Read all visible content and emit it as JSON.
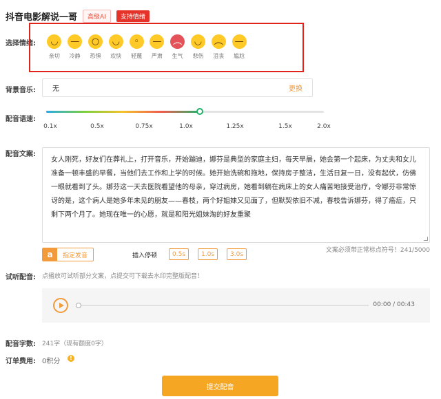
{
  "header": {
    "title": "抖音电影解说一哥",
    "badge_ai": "高级AI",
    "badge_emotion": "支持情绪"
  },
  "labels": {
    "emotion": "选择情绪:",
    "music": "背景音乐:",
    "speed": "配音语速:",
    "text": "配音文案:",
    "preview": "试听配音:",
    "count": "配音字数:",
    "fee": "订单费用:"
  },
  "emotions": [
    {
      "label": "亲切",
      "icon": "affectionate-face-icon",
      "glyph": "◡"
    },
    {
      "label": "冷静",
      "icon": "calm-face-icon",
      "glyph": "—"
    },
    {
      "label": "恐惧",
      "icon": "fearful-face-icon",
      "glyph": "○"
    },
    {
      "label": "欢快",
      "icon": "happy-face-icon",
      "glyph": "◡"
    },
    {
      "label": "轻蔑",
      "icon": "scornful-face-icon",
      "glyph": "◦"
    },
    {
      "label": "严肃",
      "icon": "serious-face-icon",
      "glyph": "—"
    },
    {
      "label": "生气",
      "icon": "angry-face-icon",
      "glyph": "︵"
    },
    {
      "label": "悲伤",
      "icon": "sad-face-icon",
      "glyph": "◡"
    },
    {
      "label": "沮丧",
      "icon": "depressed-face-icon",
      "glyph": "︵"
    },
    {
      "label": "尴尬",
      "icon": "embarrassed-face-icon",
      "glyph": "—"
    }
  ],
  "music": {
    "value": "无",
    "change_label": "更换"
  },
  "speed": {
    "ticks": [
      "0.1x",
      "0.5x",
      "0.75x",
      "1.0x",
      "1.25x",
      "1.5x",
      "2.0x"
    ],
    "tick_values": [
      0.1,
      0.5,
      0.75,
      1.0,
      1.25,
      1.5,
      2.0
    ],
    "current": 1.0
  },
  "script_text": "女人刚死，好友们在葬礼上，打开音乐，开始蹦迪，娜芬是典型的家庭主妇，每天早晨，她会第一个起床，为丈夫和女儿准备一顿丰盛的早餐，当他们去工作和上学的时候。她开始洗碗和拖地，保持房子整洁，生活日复一日，没有起伏，仿佛一眼就看到了头。娜芬这一天去医院看望他的母亲，穿过病房，她看到躺在病床上的女人痛苦地接受治疗，令娜芬非常惊讶的是，这个病人是她多年未见的朋友——春枝，两个好姐妹又见面了，但默契依旧不减，春枝告诉娜芬，得了癌症，只剩下两个月了。她现在唯一的心愿，就是和阳光姐妹淘的好友重聚",
  "tools": {
    "voice_icon": "a",
    "voice_label": "指定发音",
    "pause_label": "插入停顿",
    "pauses": [
      "0.5s",
      "1.0s",
      "3.0s"
    ],
    "char_hint": "文案必须带正常标点符号！241/5000"
  },
  "preview": {
    "hint": "点播放可试听部分文案，点提交可下载去水印完整版配音！",
    "time": "00:00 / 00:43",
    "progress": 0
  },
  "count_value": "241字（现有额度0字）",
  "fee_value": "0积分",
  "fee_info_icon": "!",
  "submit_label": "提交配音",
  "colors": {
    "accent": "#f19b3c",
    "submit": "#f5a623",
    "highlight_border": "#e0241b",
    "badge_red": "#e5332a"
  }
}
